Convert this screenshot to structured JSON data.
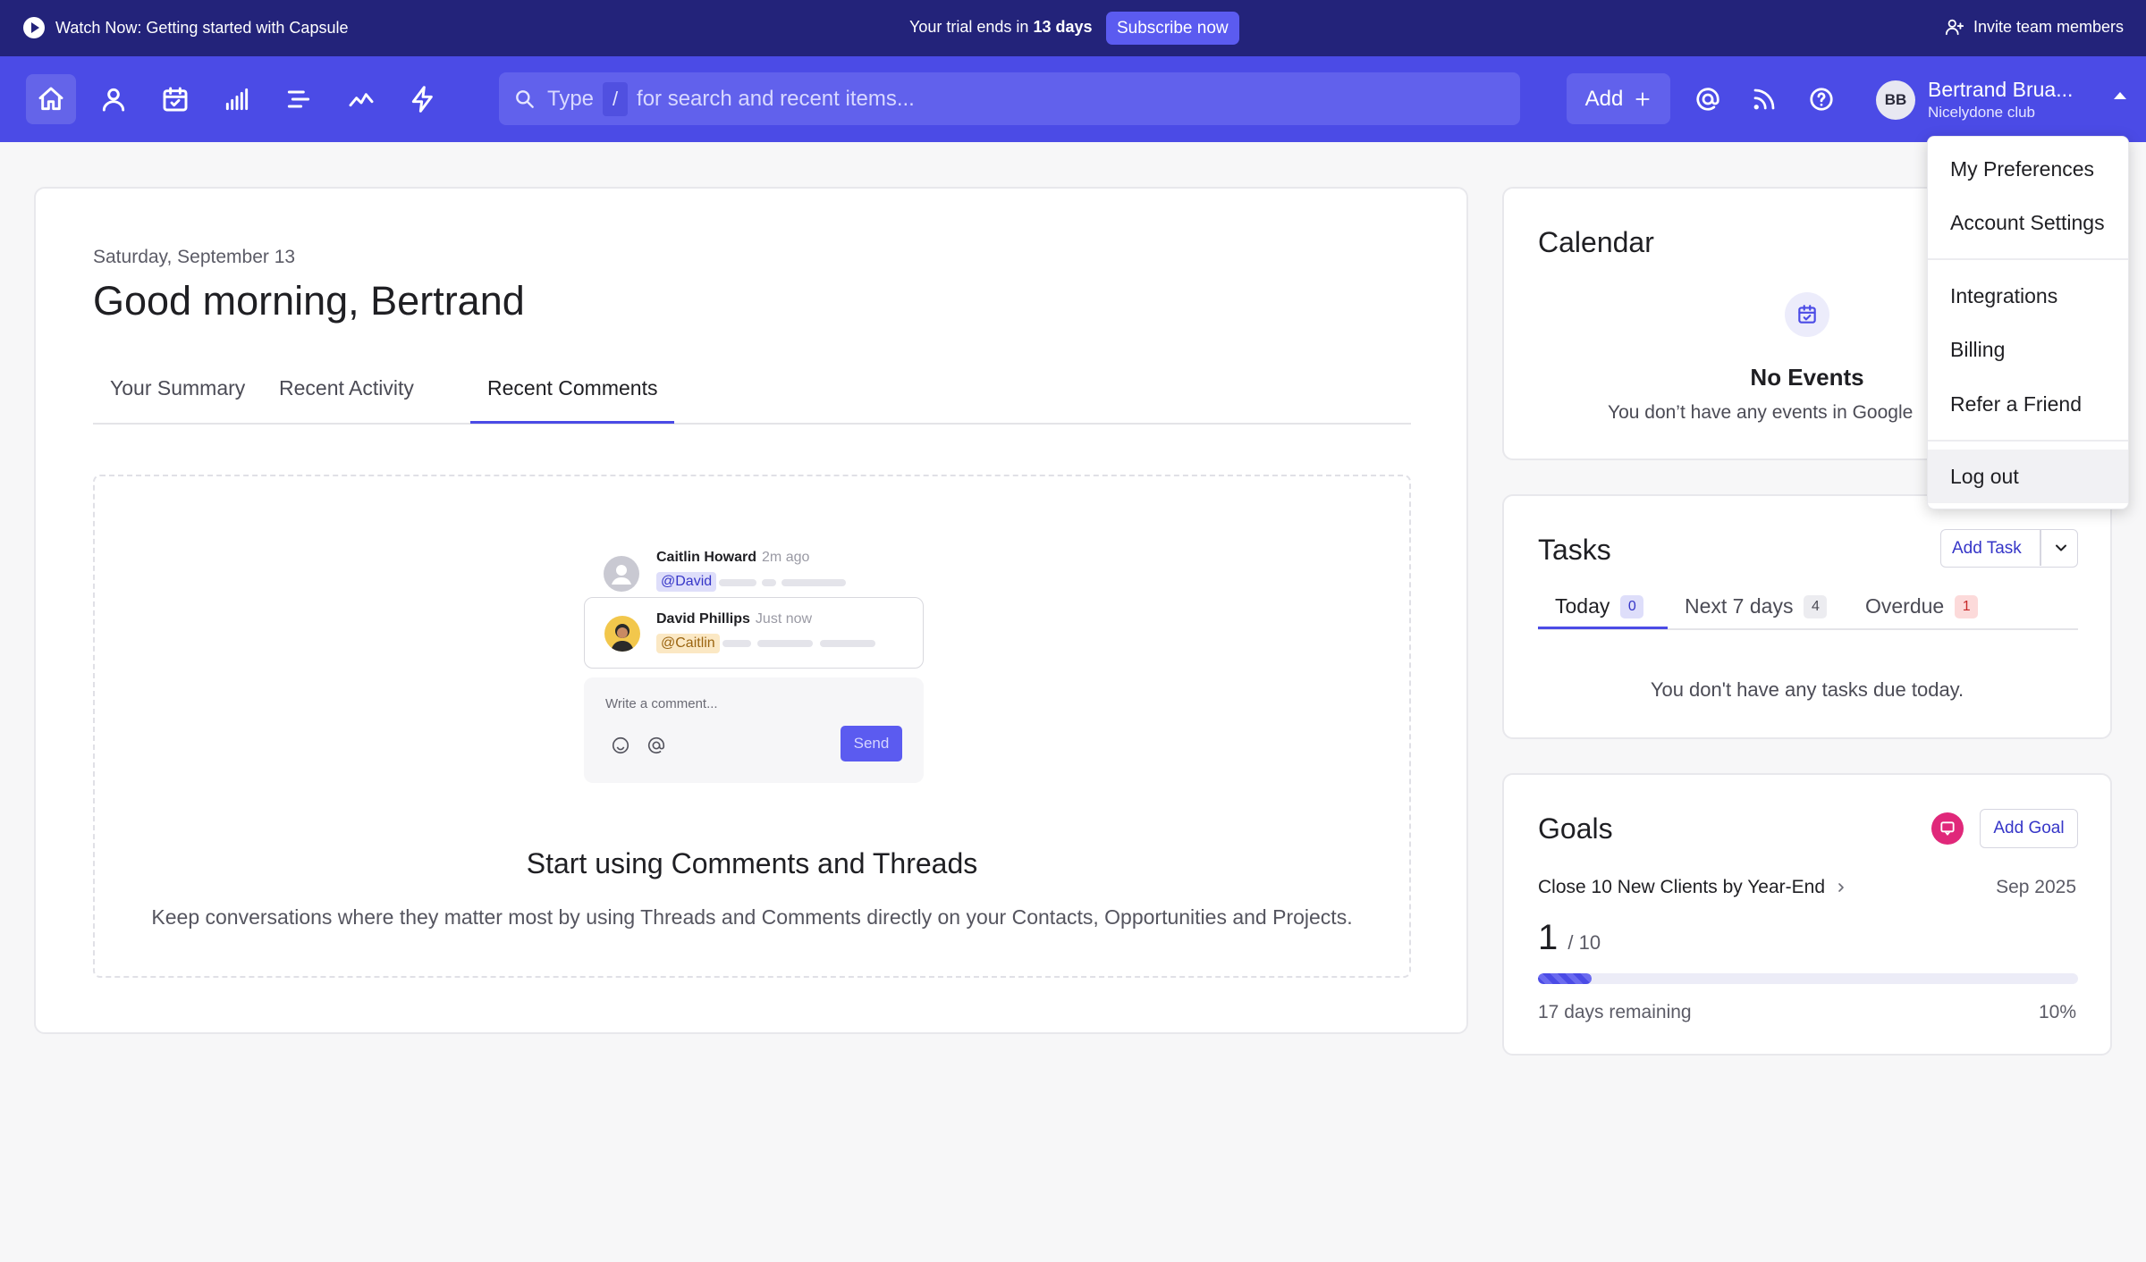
{
  "promo": {
    "watch_label": "Watch Now: Getting started with Capsule",
    "trial_prefix": "Your trial ends in",
    "trial_days": "13 days",
    "subscribe_label": "Subscribe now",
    "invite_label": "Invite team members"
  },
  "nav": {
    "search_type": "Type",
    "search_key": "/",
    "search_rest": "for search and recent items...",
    "add_label": "Add",
    "user_initials": "BB",
    "user_name": "Bertrand Brua...",
    "user_org": "Nicelydone club"
  },
  "main": {
    "date": "Saturday, September 13",
    "greeting": "Good morning, Bertrand",
    "tabs": [
      {
        "label": "Your Summary"
      },
      {
        "label": "Recent Activity"
      },
      {
        "label": "Recent Comments"
      }
    ],
    "preview": {
      "comment1": {
        "name": "Caitlin Howard",
        "time": "2m ago",
        "mention": "@David"
      },
      "comment2": {
        "name": "David Phillips",
        "time": "Just now",
        "mention": "@Caitlin"
      },
      "composer_placeholder": "Write a comment...",
      "send_label": "Send"
    },
    "cta_title": "Start using Comments and Threads",
    "cta_desc": "Keep conversations where they matter most by using Threads and Comments directly on your Contacts, Opportunities and Projects."
  },
  "calendar": {
    "title": "Calendar",
    "empty_title": "No Events",
    "empty_desc": "You don’t have any events in Google"
  },
  "tasks": {
    "title": "Tasks",
    "add_label": "Add Task",
    "tabs": [
      {
        "label": "Today",
        "count": "0"
      },
      {
        "label": "Next 7 days",
        "count": "4"
      },
      {
        "label": "Overdue",
        "count": "1"
      }
    ],
    "empty": "You don't have any tasks due today."
  },
  "goals": {
    "title": "Goals",
    "add_label": "Add Goal",
    "goal_name": "Close 10 New Clients by Year-End",
    "goal_date": "Sep 2025",
    "current": "1",
    "target": "/ 10",
    "progress_fraction": 0.1,
    "remaining": "17 days remaining",
    "percent": "10%"
  },
  "dropdown": {
    "items": [
      {
        "label": "My Preferences"
      },
      {
        "label": "Account Settings"
      },
      {
        "label": "Integrations"
      },
      {
        "label": "Billing"
      },
      {
        "label": "Refer a Friend"
      },
      {
        "label": "Log out"
      }
    ]
  },
  "colors": {
    "promo_bg": "#23237a",
    "nav_bg": "#4b4be6",
    "accent": "#5b5bf0",
    "goal_icon": "#e0287a"
  }
}
